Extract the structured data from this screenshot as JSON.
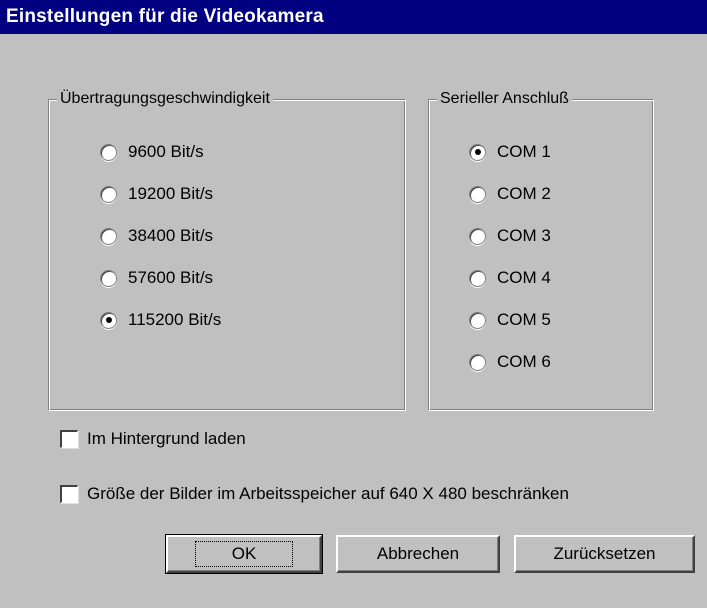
{
  "window": {
    "title": "Einstellungen für die Videokamera"
  },
  "speed_group": {
    "legend": "Übertragungsgeschwindigkeit",
    "options": [
      {
        "label": "9600 Bit/s",
        "selected": false
      },
      {
        "label": "19200 Bit/s",
        "selected": false
      },
      {
        "label": "38400 Bit/s",
        "selected": false
      },
      {
        "label": "57600 Bit/s",
        "selected": false
      },
      {
        "label": "115200 Bit/s",
        "selected": true
      }
    ]
  },
  "port_group": {
    "legend": "Serieller Anschluß",
    "options": [
      {
        "label": "COM 1",
        "selected": true
      },
      {
        "label": "COM 2",
        "selected": false
      },
      {
        "label": "COM 3",
        "selected": false
      },
      {
        "label": "COM 4",
        "selected": false
      },
      {
        "label": "COM 5",
        "selected": false
      },
      {
        "label": "COM 6",
        "selected": false
      }
    ]
  },
  "checkboxes": [
    {
      "label": "Im Hintergrund laden",
      "checked": false
    },
    {
      "label": "Größe der Bilder im Arbeitsspeicher auf 640 X 480 beschränken",
      "checked": false
    }
  ],
  "buttons": {
    "ok": "OK",
    "cancel": "Abbrechen",
    "reset": "Zurücksetzen"
  }
}
